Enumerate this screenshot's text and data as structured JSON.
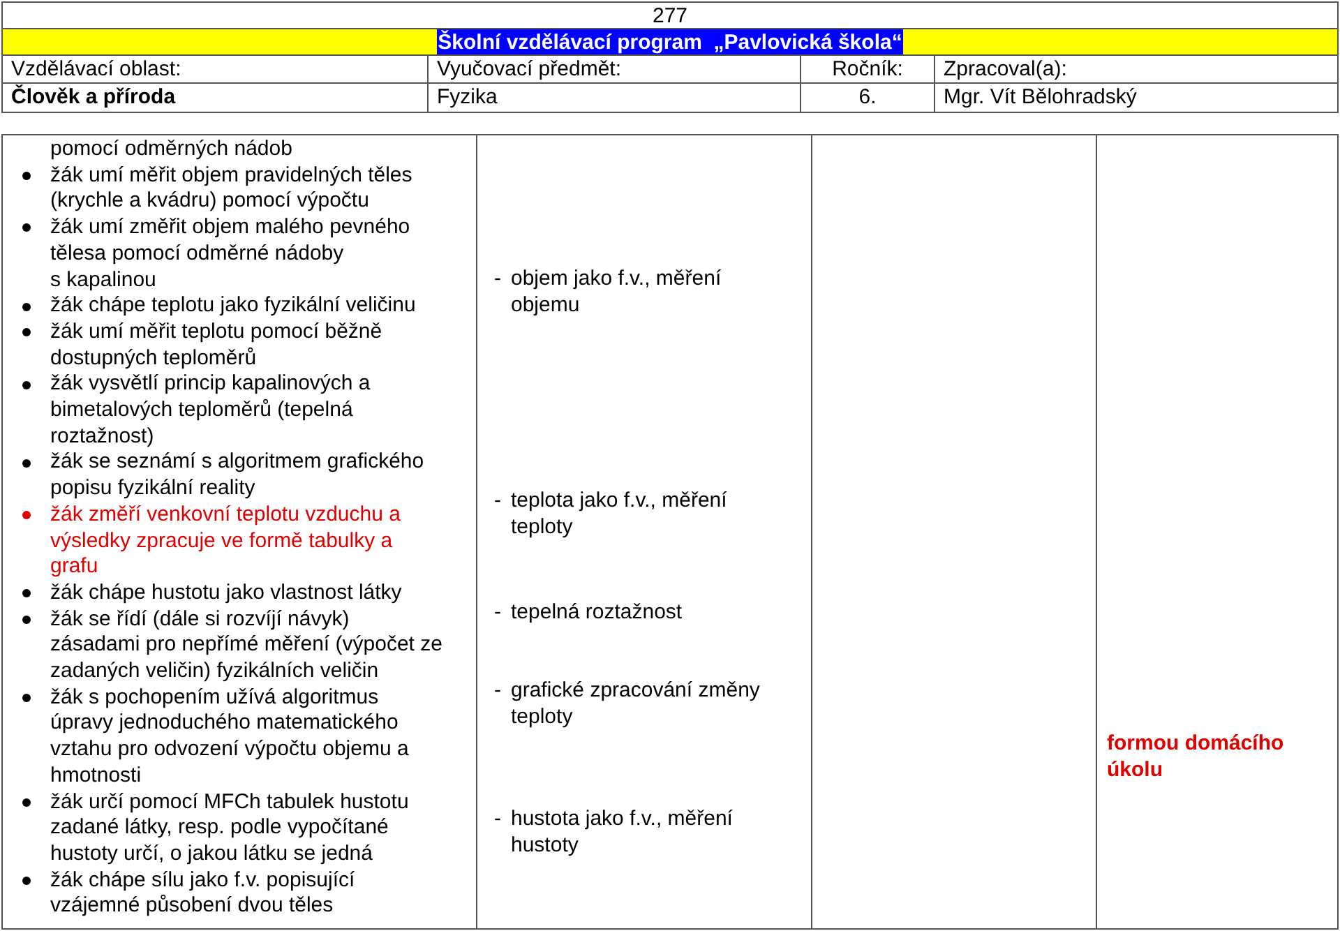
{
  "header": {
    "page_number": "277",
    "title": "Školní vzdělávací program  „Pavlovická škola“",
    "labels": [
      "Vzdělávací oblast:",
      "Vyučovací předmět:",
      "Ročník:",
      "Zpracoval(a):"
    ],
    "values": [
      {
        "text": "Člověk a příroda",
        "bold": true
      },
      {
        "text": "Fyzika",
        "bold": false
      },
      {
        "text": "6.",
        "bold": false
      },
      {
        "text": "Mgr. Vít Bělohradský",
        "bold": false
      }
    ]
  },
  "table": {
    "outcomes": [
      {
        "text": "pomocí odměrných nádob",
        "bullet": false,
        "highlighted": false
      },
      {
        "text": "žák umí měřit objem pravidelných těles (krychle a kvádru) pomocí výpočtu",
        "bullet": true,
        "highlighted": false
      },
      {
        "text": "žák umí změřit objem malého pevného tělesa pomocí odměrné nádoby s kapalinou",
        "bullet": true,
        "highlighted": false
      },
      {
        "text": "žák chápe teplotu jako fyzikální veličinu",
        "bullet": true,
        "highlighted": false
      },
      {
        "text": "žák umí měřit teplotu pomocí běžně dostupných teploměrů",
        "bullet": true,
        "highlighted": false
      },
      {
        "text": "žák vysvětlí princip kapalinových a bimetalových teploměrů (tepelná roztažnost)",
        "bullet": true,
        "highlighted": false
      },
      {
        "text": "žák se seznámí s algoritmem grafického popisu fyzikální reality",
        "bullet": true,
        "highlighted": false
      },
      {
        "text": "žák změří venkovní teplotu vzduchu a výsledky zpracuje ve formě tabulky a grafu",
        "bullet": true,
        "highlighted": true
      },
      {
        "text": "žák chápe hustotu jako vlastnost látky",
        "bullet": true,
        "highlighted": false
      },
      {
        "text": "žák se řídí (dále si rozvíjí návyk) zásadami pro nepřímé měření (výpočet ze zadaných veličin) fyzikálních veličin",
        "bullet": true,
        "highlighted": false
      },
      {
        "text": "žák s pochopením užívá algoritmus úpravy jednoduchého matematického vztahu pro odvození výpočtu objemu a hmotnosti",
        "bullet": true,
        "highlighted": false
      },
      {
        "text": "žák určí pomocí MFCh tabulek hustotu zadané látky, resp. podle vypočítané hustoty určí, o jakou látku se jedná",
        "bullet": true,
        "highlighted": false
      },
      {
        "text": "žák chápe sílu jako f.v. popisující vzájemné působení dvou těles",
        "bullet": true,
        "highlighted": false
      }
    ],
    "topics": [
      {
        "dash": "-",
        "text": "objem jako f.v., měření objemu"
      },
      {
        "dash": "-",
        "text": "teplota jako f.v., měření teploty"
      },
      {
        "dash": "-",
        "text": "tepelná roztažnost"
      },
      {
        "dash": "-",
        "text": "grafické zpracování změny teploty"
      },
      {
        "dash": "-",
        "text": "hustota jako f.v., měření hustoty"
      }
    ],
    "note": "formou domácího úkolu"
  }
}
